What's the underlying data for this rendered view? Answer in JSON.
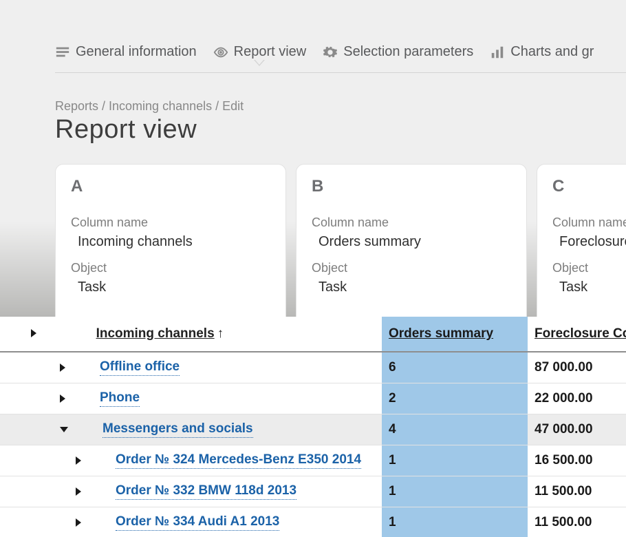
{
  "tabs": [
    {
      "label": "General information"
    },
    {
      "label": "Report view"
    },
    {
      "label": "Selection parameters"
    },
    {
      "label": "Charts and gr"
    }
  ],
  "breadcrumb": "Reports / Incoming channels / Edit",
  "page_title": "Report view",
  "cards": [
    {
      "letter": "A",
      "name_label": "Column name",
      "name_value": "Incoming channels",
      "object_label": "Object",
      "object_value": "Task"
    },
    {
      "letter": "B",
      "name_label": "Column name",
      "name_value": "Orders summary",
      "object_label": "Object",
      "object_value": "Task"
    },
    {
      "letter": "C",
      "name_label": "Column name",
      "name_value": "Foreclosure Co",
      "object_label": "Object",
      "object_value": "Task"
    }
  ],
  "table": {
    "sort_arrow": "↑",
    "headers": {
      "name": "Incoming channels",
      "orders": "Orders summary",
      "fc": "Foreclosure Co"
    },
    "rows": [
      {
        "indent": 1,
        "expanded": false,
        "link": true,
        "name": "Offline office",
        "orders": "6",
        "fc": "87 000.00"
      },
      {
        "indent": 1,
        "expanded": false,
        "link": true,
        "name": "Phone",
        "orders": "2",
        "fc": "22 000.00"
      },
      {
        "indent": 1,
        "expanded": true,
        "link": true,
        "name": "Messengers and socials",
        "orders": "4",
        "fc": "47 000.00"
      },
      {
        "indent": 2,
        "expanded": false,
        "link": true,
        "name": "Order № 324 Mercedes-Benz E350 2014",
        "orders": "1",
        "fc": "16 500.00"
      },
      {
        "indent": 2,
        "expanded": false,
        "link": true,
        "name": "Order № 332 BMW 118d 2013",
        "orders": "1",
        "fc": "11 500.00"
      },
      {
        "indent": 2,
        "expanded": false,
        "link": true,
        "name": "Order № 334 Audi A1 2013",
        "orders": "1",
        "fc": "11 500.00"
      }
    ]
  }
}
